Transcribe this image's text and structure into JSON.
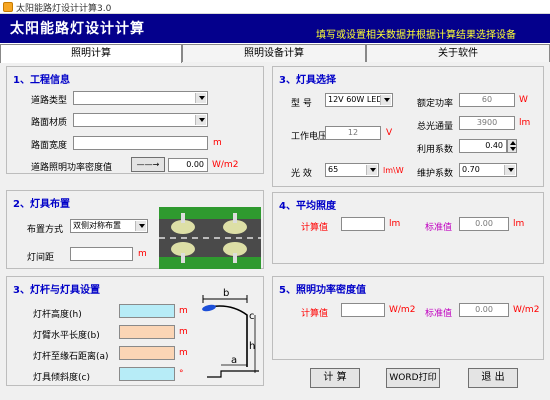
{
  "window": {
    "title": "太阳能路灯设计计算3.0"
  },
  "banner": {
    "title": "太阳能路灯设计计算",
    "hint": "填写或设置相关数据并根据计算结果选择设备"
  },
  "tabs": [
    {
      "label": "照明计算",
      "active": true
    },
    {
      "label": "照明设备计算",
      "active": false
    },
    {
      "label": "关于软件",
      "active": false
    }
  ],
  "project": {
    "title": "1、工程信息",
    "road_type_label": "道路类型",
    "road_type_value": "",
    "road_material_label": "路面材质",
    "road_material_value": "",
    "road_width_label": "路面宽度",
    "road_width_value": "",
    "road_width_unit": "m",
    "lpd_label": "道路照明功率密度值",
    "lpd_arrow": "——→",
    "lpd_value": "0.00",
    "lpd_unit": "W/m2"
  },
  "layout": {
    "title": "2、灯具布置",
    "mode_label": "布置方式",
    "mode_value": "双侧对称布置",
    "spacing_label": "灯间距",
    "spacing_value": "",
    "spacing_unit": "m"
  },
  "pole": {
    "title": "3、灯杆与灯具设置",
    "height_label": "灯杆高度(h)",
    "height_unit": "m",
    "arm_label": "灯臂水平长度(b)",
    "arm_unit": "m",
    "curb_label": "灯杆至缘石距离(a)",
    "curb_unit": "m",
    "tilt_label": "灯具倾斜度(c)",
    "tilt_unit": "°",
    "diagram": {
      "b": "b",
      "c": "c",
      "h": "h",
      "a": "a"
    },
    "colors": {
      "cyan": "#b7ecf7",
      "peach": "#fbd5b5"
    }
  },
  "fixture": {
    "title": "3、灯具选择",
    "model_label": "型 号",
    "model_value": "12V 60W LED灯",
    "voltage_label": "工作电压",
    "voltage_value": "12",
    "voltage_unit": "V",
    "efficacy_label": "光 效",
    "efficacy_value": "65",
    "efficacy_unit": "lm\\W",
    "power_label": "额定功率",
    "power_value": "60",
    "power_unit": "W",
    "flux_label": "总光通量",
    "flux_value": "3900",
    "flux_unit": "lm",
    "util_label": "利用系数",
    "util_value": "0.40",
    "maint_label": "维护系数",
    "maint_value": "0.70"
  },
  "illuminance": {
    "title": "4、平均照度",
    "calc_label": "计算值",
    "calc_value": "",
    "calc_unit": "lm",
    "std_label": "标准值",
    "std_value": "0.00",
    "std_unit": "lm"
  },
  "density": {
    "title": "5、照明功率密度值",
    "calc_label": "计算值",
    "calc_value": "",
    "calc_unit": "W/m2",
    "std_label": "标准值",
    "std_value": "0.00",
    "std_unit": "W/m2"
  },
  "buttons": {
    "calculate": "计 算",
    "export": "WORD打印",
    "exit": "退 出"
  }
}
